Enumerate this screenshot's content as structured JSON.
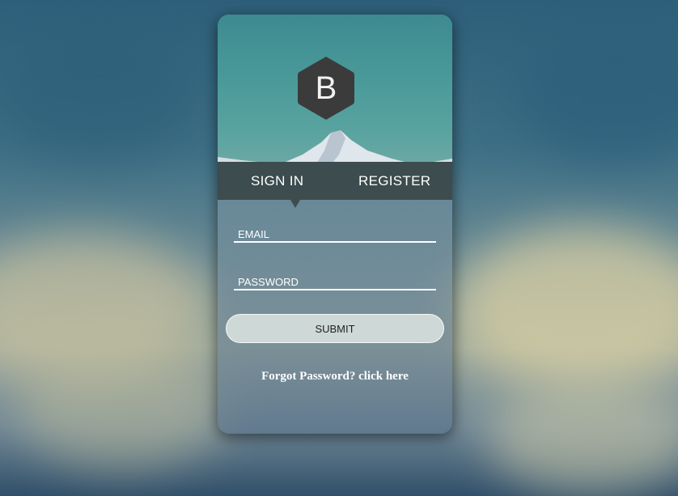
{
  "logo": {
    "letter": "B",
    "icon": "hexagon-logo-icon",
    "color": "#3b3b3b"
  },
  "tabs": [
    {
      "label": "SIGN IN",
      "active": true
    },
    {
      "label": "REGISTER",
      "active": false
    }
  ],
  "form": {
    "email": {
      "placeholder": "EMAIL",
      "value": ""
    },
    "password": {
      "placeholder": "PASSWORD",
      "value": ""
    },
    "submit_label": "SUBMIT",
    "forgot_text": "Forgot Password?",
    "forgot_link": "click here"
  },
  "colors": {
    "tab_bar": "#34403e",
    "hero_sky": "#4a9a9a",
    "text": "#ffffff"
  }
}
